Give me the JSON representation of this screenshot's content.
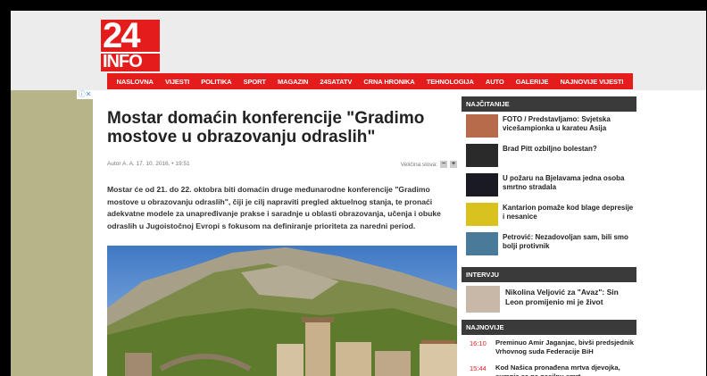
{
  "ad": {
    "choices_label": "ⓘ✕"
  },
  "logo": {
    "number": "24",
    "text": "INFO"
  },
  "nav": {
    "items": [
      "NASLOVNA",
      "VIJESTI",
      "POLITIKA",
      "SPORT",
      "MAGAZIN",
      "24SATATV",
      "CRNA HRONIKA",
      "TEHNOLOGIJA",
      "AUTO",
      "GALERIJE",
      "NAJNOVIJE VIJESTI"
    ]
  },
  "article": {
    "title": "Mostar domaćin konferencije \"Gradimo mostove u obrazovanju odraslih\"",
    "author_line": "Autor A. A. 17. 10. 2016. • 19:51",
    "font_size_label": "Veličina slova:",
    "font_minus": "−",
    "font_plus": "+",
    "lead": "Mostar će od 21. do 22. oktobra biti domaćin druge međunarodne konferencije \"Gradimo mostove u obrazovanju odraslih\", čiji je cilj napraviti pregled aktuelnog stanja, te pronaći adekvatne modele za unapređivanje prakse i saradnje u oblasti obrazovanja, učenja i obuke odraslih u Jugoistočnoj Evropi s fokusom na definiranje prioriteta za naredni period."
  },
  "sidebar": {
    "popular_title": "NAJČITANIJE",
    "popular": [
      {
        "text": "FOTO / Predstavljamo: Svjetska vicešampionka u karateu Asija",
        "color": "#b86b4a"
      },
      {
        "text": "Brad Pitt ozbiljno bolestan?",
        "color": "#2a2a2a"
      },
      {
        "text": "U požaru na Bjelavama jedna osoba smrtno stradala",
        "color": "#1a1a22"
      },
      {
        "text": "Kantarion pomaže kod blage depresije i nesanice",
        "color": "#d9c21e"
      },
      {
        "text": "Petrović: Nezadovoljan sam, bili smo bolji protivnik",
        "color": "#4a7a9a"
      }
    ],
    "interview_title": "INTERVJU",
    "interview": {
      "text": "Nikolina Veljović za \"Avaz\": Sin Leon promijenio mi je život",
      "color": "#c8b8a8"
    },
    "newest_title": "NAJNOVIJE",
    "newest": [
      {
        "time": "16:10",
        "text": "Preminuo Amir Jaganjac, bivši predsjednik Vrhovnog suda Federacije BiH"
      },
      {
        "time": "15:44",
        "text": "Kod Našica pronađena mrtva djevojka, sumnja se na nasilnu smrt"
      }
    ]
  }
}
